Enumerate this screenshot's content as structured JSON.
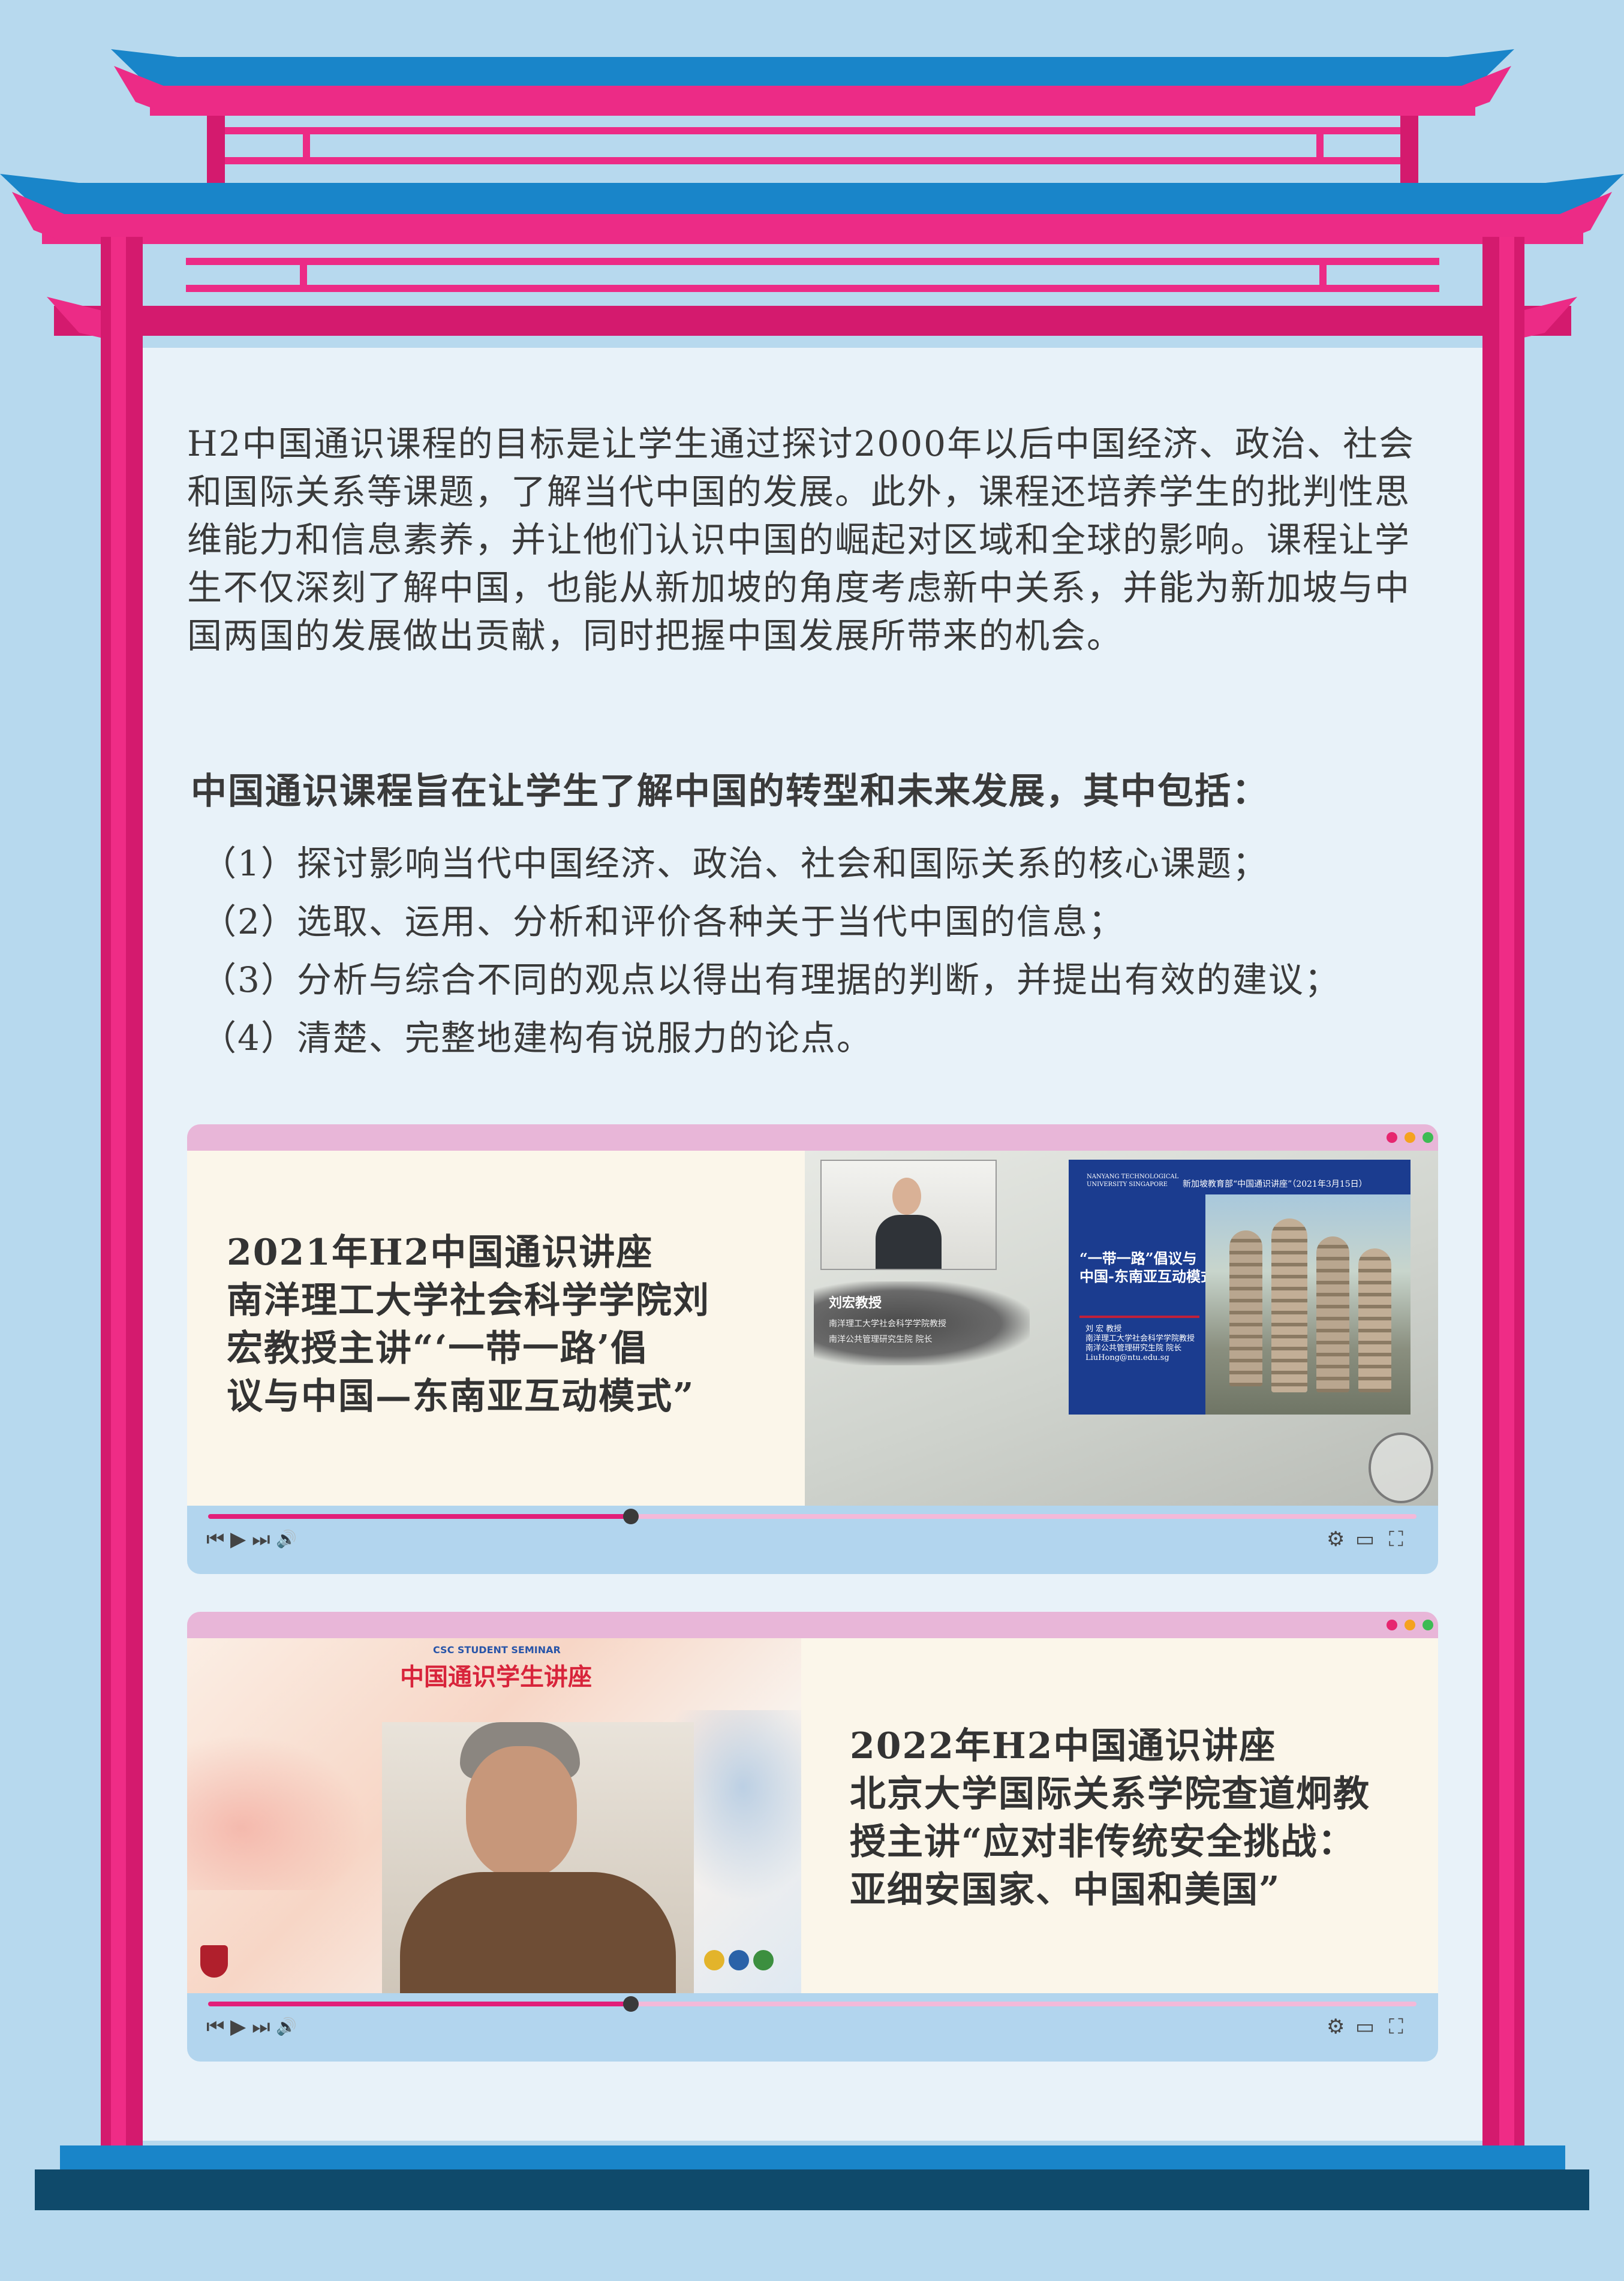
{
  "intro_paragraph": "H2中国通识课程的目标是让学生通过探讨2000年以后中国经济、政治、社会和国际关系等课题，了解当代中国的发展。此外，课程还培养学生的批判性思维能力和信息素养，并让他们认识中国的崛起对区域和全球的影响。课程让学生不仅深刻了解中国，也能从新加坡的角度考虑新中关系，并能为新加坡与中国两国的发展做出贡献，同时把握中国发展所带来的机会。",
  "aims_heading": "中国通识课程旨在让学生了解中国的转型和未来发展，其中包括：",
  "aims": [
    "（1）探讨影响当代中国经济、政治、社会和国际关系的核心课题；",
    "（2）选取、运用、分析和评价各种关于当代中国的信息；",
    "（3）分析与综合不同的观点以得出有理据的判断，并提出有效的建议；",
    "（4）清楚、完整地建构有说服力的论点。"
  ],
  "video1": {
    "title_lines": [
      "2021年H2中国通识讲座",
      "南洋理工大学社会科学学院刘",
      "宏教授主讲“‘一带一路’倡",
      "议与中国—东南亚互动模式”"
    ],
    "speaker_name": "刘宏教授",
    "speaker_role_1": "南洋理工大学社会科学学院教授",
    "speaker_role_2": "南洋公共管理研究生院 院长",
    "slide_univ": "NANYANG TECHNOLOGICAL UNIVERSITY SINGAPORE",
    "slide_header": "新加坡教育部“中国通识讲座”（2021年3月15日）",
    "slide_title_1": "“一带一路”倡议与",
    "slide_title_2": "中国-东南亚互动模式",
    "slide_author": "刘 宏 教授",
    "slide_author_role_1": "南洋理工大学社会科学学院教授",
    "slide_author_role_2": "南洋公共管理研究生院 院长",
    "slide_email": "LiuHong@ntu.edu.sg",
    "progress": 0.35
  },
  "video2": {
    "title_lines": [
      "2022年H2中国通识讲座",
      "北京大学国际关系学院查道炯教",
      "授主讲“应对非传统安全挑战：",
      "亚细安国家、中国和美国”"
    ],
    "seminar_en": "CSC STUDENT SEMINAR",
    "seminar_cn": "中国通识学生讲座",
    "progress": 0.35
  },
  "controls": {
    "prev": "⏮",
    "play": "▶",
    "next": "⏭",
    "volume": "🔊",
    "settings": "⚙",
    "theater": "▭",
    "fullscreen": "⛶"
  },
  "colors": {
    "pink": "#ec2b86",
    "dark_pink": "#d41a6e",
    "blue": "#1985c9",
    "sky": "#b7d9ee",
    "navy": "#0f4a6b"
  }
}
